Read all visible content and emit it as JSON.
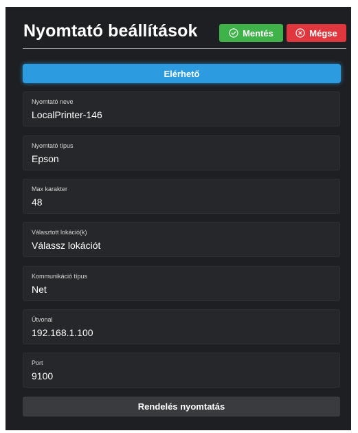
{
  "header": {
    "title": "Nyomtató beállítások",
    "save_label": "Mentés",
    "cancel_label": "Mégse"
  },
  "status": {
    "label": "Elérhető"
  },
  "fields": [
    {
      "label": "Nyomtató neve",
      "value": "LocalPrinter-146"
    },
    {
      "label": "Nyomtató típus",
      "value": "Epson"
    },
    {
      "label": "Max karakter",
      "value": "48"
    },
    {
      "label": "Választott lokáció(k)",
      "value": "Válassz lokációt"
    },
    {
      "label": "Kommunikáció típus",
      "value": "Net"
    },
    {
      "label": "Útvonal",
      "value": "192.168.1.100"
    },
    {
      "label": "Port",
      "value": "9100"
    }
  ],
  "footer": {
    "print_label": "Rendelés nyomtatás"
  },
  "colors": {
    "panel_bg": "#1e1f22",
    "field_bg": "#26272b",
    "accent_blue": "#2d9be0",
    "save_green": "#3fb24a",
    "cancel_red": "#e0363d"
  },
  "icons": {
    "save": "check-circle-icon",
    "cancel": "x-circle-icon"
  }
}
